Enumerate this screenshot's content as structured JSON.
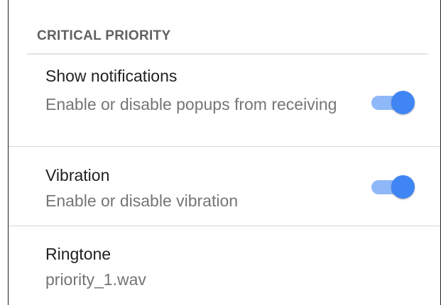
{
  "section": {
    "header": "CRITICAL PRIORITY"
  },
  "preferences": [
    {
      "title": "Show notifications",
      "summary": "Enable or disable popups from receiving",
      "switch": {
        "enabled": true
      }
    },
    {
      "title": "Vibration",
      "summary": "Enable or disable vibration",
      "switch": {
        "enabled": true
      }
    },
    {
      "title": "Ringtone",
      "summary": "priority_1.wav"
    }
  ],
  "colors": {
    "accent": "#3f86f4",
    "switch_track": "#8fb8f8",
    "header_text": "#616161",
    "title_text": "#212121",
    "summary_text": "#757575"
  }
}
